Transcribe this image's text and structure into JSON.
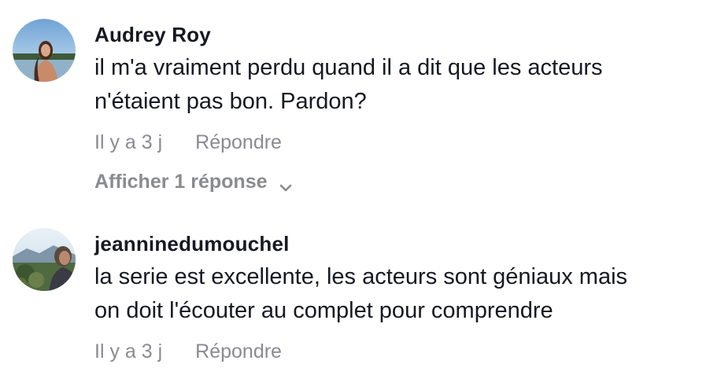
{
  "comments": [
    {
      "username": "Audrey Roy",
      "text_line1": "il m'a vraiment perdu quand il a dit que les acteurs",
      "text_line2": "n'étaient pas bon. Pardon?",
      "time": "Il y a 3 j",
      "reply_label": "Répondre",
      "view_replies_label": "Afficher 1 réponse",
      "avatar_icon": "avatar-photo"
    },
    {
      "username": "jeanninedumouchel",
      "text_line1": "la serie est excellente, les acteurs sont géniaux mais",
      "text_line2": "on doit l'écouter au complet pour comprendre",
      "time": "Il y a 3 j",
      "reply_label": "Répondre",
      "avatar_icon": "avatar-photo"
    }
  ],
  "colors": {
    "text": "#161823",
    "muted": "#8a8b91",
    "background": "#ffffff"
  }
}
